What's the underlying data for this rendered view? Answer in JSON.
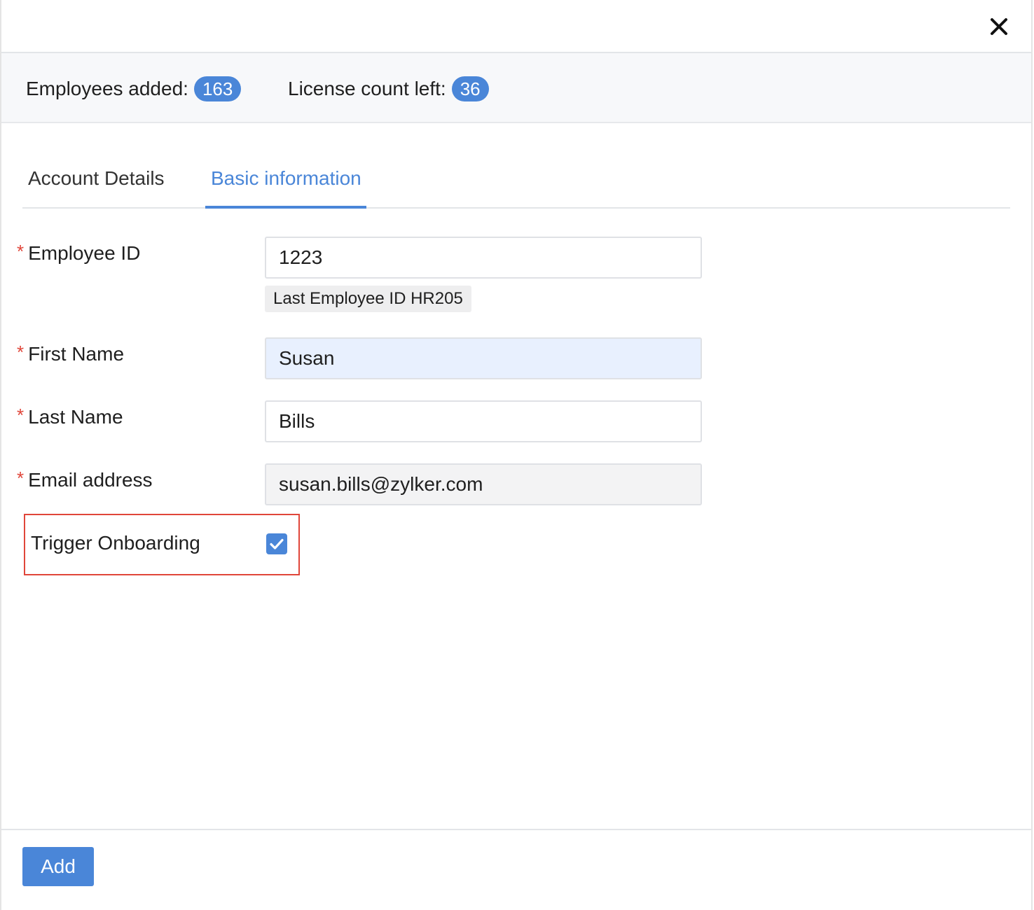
{
  "header": {
    "close_icon": "close-icon"
  },
  "stats": {
    "employees_added_label": "Employees added:",
    "employees_added_count": "163",
    "license_left_label": "License count left:",
    "license_left_count": "36",
    "badge_color": "#4a86d8"
  },
  "tabs": [
    {
      "label": "Account Details",
      "active": false
    },
    {
      "label": "Basic information",
      "active": true
    }
  ],
  "form": {
    "employee_id": {
      "label": "Employee ID",
      "required_mark": "*",
      "value": "1223",
      "hint": "Last Employee ID HR205"
    },
    "first_name": {
      "label": "First Name",
      "required_mark": "*",
      "value": "Susan"
    },
    "last_name": {
      "label": "Last Name",
      "required_mark": "*",
      "value": "Bills"
    },
    "email": {
      "label": "Email address",
      "required_mark": "*",
      "value": "susan.bills@zylker.com"
    },
    "trigger_onboarding": {
      "label": "Trigger Onboarding",
      "checked": true
    }
  },
  "footer": {
    "add_label": "Add"
  },
  "colors": {
    "accent": "#4a86d8",
    "required": "#e0463a",
    "highlight_border": "#e0463a"
  }
}
